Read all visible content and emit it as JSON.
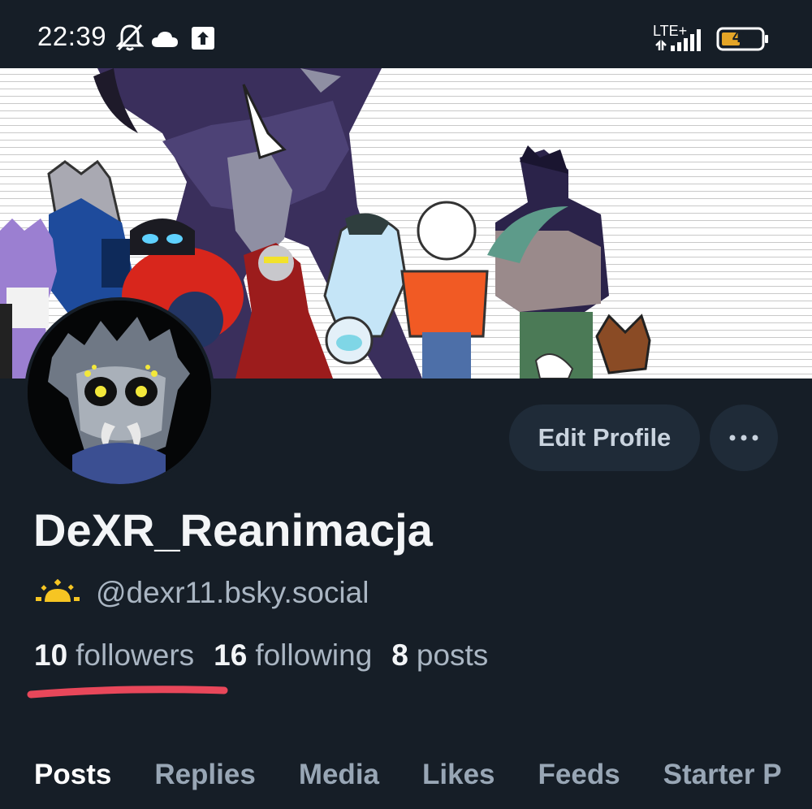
{
  "status_bar": {
    "time": "22:39",
    "network": "LTE+",
    "battery": "41",
    "icons": [
      "bell-off-icon",
      "cloud-icon",
      "upload-icon",
      "signal-icon",
      "battery-icon"
    ]
  },
  "profile": {
    "display_name": "DeXR_Reanimacja",
    "handle": "@dexr11.bsky.social",
    "handle_icon": "sun-emoji-icon",
    "edit_button": "Edit Profile",
    "more_button_icon": "more-dots-icon"
  },
  "stats": {
    "followers_count": "10",
    "followers_label": "followers",
    "following_count": "16",
    "following_label": "following",
    "posts_count": "8",
    "posts_label": "posts",
    "highlight_color": "#e8475a"
  },
  "tabs": [
    {
      "label": "Posts",
      "active": true
    },
    {
      "label": "Replies",
      "active": false
    },
    {
      "label": "Media",
      "active": false
    },
    {
      "label": "Likes",
      "active": false
    },
    {
      "label": "Feeds",
      "active": false
    },
    {
      "label": "Starter P",
      "active": false
    }
  ],
  "colors": {
    "background": "#161e27",
    "button_bg": "#1f2b38",
    "muted_text": "#aab6c3"
  }
}
